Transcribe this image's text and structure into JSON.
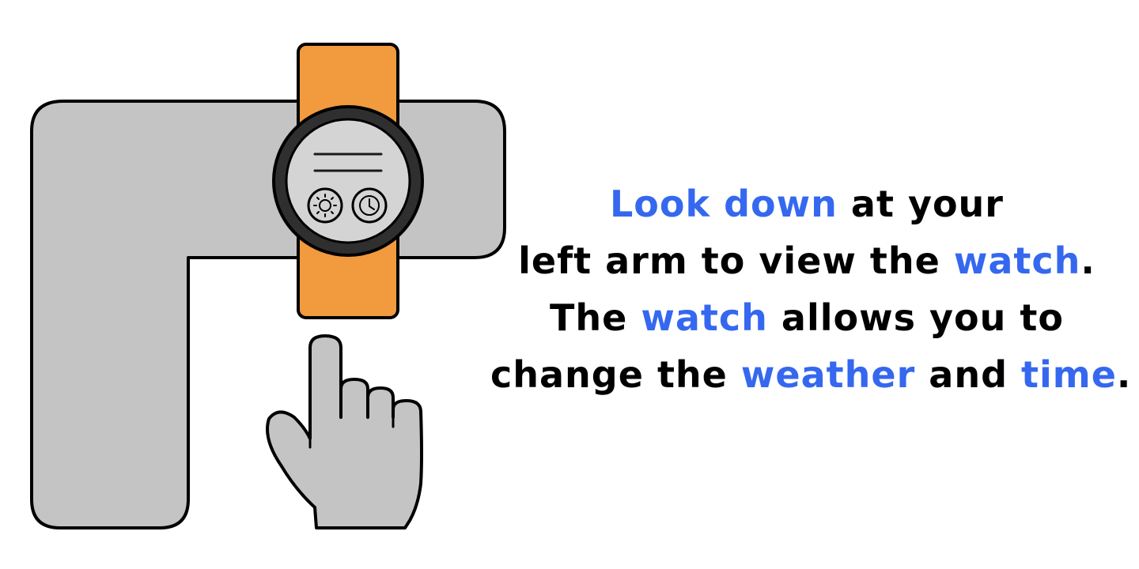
{
  "colors": {
    "highlight": "#3568ef",
    "text": "#000000",
    "arm": "#c4c4c4",
    "strap": "#f19a3e",
    "bezel": "#2f2f2f",
    "watch_face": "#d4d4d4",
    "outline": "#000000",
    "background": "#ffffff"
  },
  "illustration": {
    "watch_icons": [
      "sun-icon",
      "clock-icon"
    ],
    "hand_icon": "pointing-hand-icon"
  },
  "instructions": [
    [
      {
        "text": "Look down",
        "highlight": true
      },
      {
        "text": " at your",
        "highlight": false
      }
    ],
    [
      {
        "text": "left arm to view the ",
        "highlight": false
      },
      {
        "text": "watch",
        "highlight": true
      },
      {
        "text": ".",
        "highlight": false
      }
    ],
    [
      {
        "text": "The ",
        "highlight": false
      },
      {
        "text": "watch",
        "highlight": true
      },
      {
        "text": " allows you to",
        "highlight": false
      }
    ],
    [
      {
        "text": "change the ",
        "highlight": false
      },
      {
        "text": "weather",
        "highlight": true
      },
      {
        "text": " and ",
        "highlight": false
      },
      {
        "text": "time",
        "highlight": true
      },
      {
        "text": ".",
        "highlight": false
      }
    ]
  ]
}
